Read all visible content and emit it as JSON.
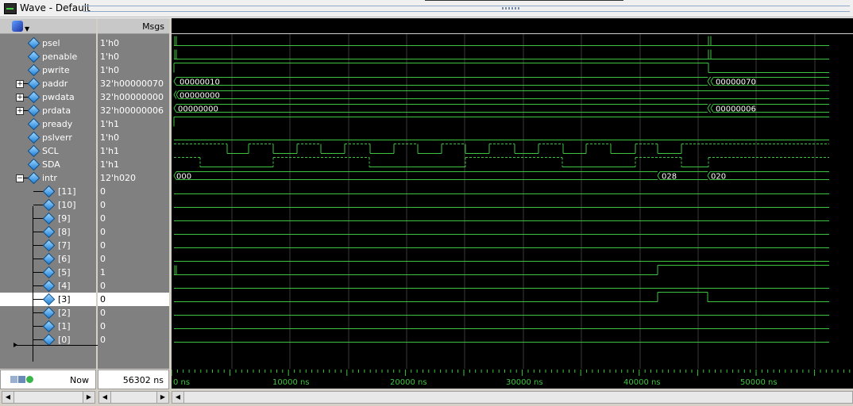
{
  "window": {
    "title": "Wave - Default"
  },
  "header": {
    "msgs_label": "Msgs"
  },
  "signals": [
    {
      "name": "psel",
      "value": "1'h0",
      "expandable": false,
      "expanded": false
    },
    {
      "name": "penable",
      "value": "1'h0",
      "expandable": false,
      "expanded": false
    },
    {
      "name": "pwrite",
      "value": "1'h0",
      "expandable": false,
      "expanded": false
    },
    {
      "name": "paddr",
      "value": "32'h00000070",
      "expandable": true,
      "expanded": false
    },
    {
      "name": "pwdata",
      "value": "32'h00000000",
      "expandable": true,
      "expanded": false
    },
    {
      "name": "prdata",
      "value": "32'h00000006",
      "expandable": true,
      "expanded": false
    },
    {
      "name": "pready",
      "value": "1'h1",
      "expandable": false,
      "expanded": false
    },
    {
      "name": "pslverr",
      "value": "1'h0",
      "expandable": false,
      "expanded": false
    },
    {
      "name": "SCL",
      "value": "1'h1",
      "expandable": false,
      "expanded": false
    },
    {
      "name": "SDA",
      "value": "1'h1",
      "expandable": false,
      "expanded": false
    },
    {
      "name": "intr",
      "value": "12'h020",
      "expandable": true,
      "expanded": true
    }
  ],
  "intr_bits": [
    {
      "name": "[11]",
      "value": "0"
    },
    {
      "name": "[10]",
      "value": "0"
    },
    {
      "name": "[9]",
      "value": "0"
    },
    {
      "name": "[8]",
      "value": "0"
    },
    {
      "name": "[7]",
      "value": "0"
    },
    {
      "name": "[6]",
      "value": "0"
    },
    {
      "name": "[5]",
      "value": "1"
    },
    {
      "name": "[4]",
      "value": "0"
    },
    {
      "name": "[3]",
      "value": "0",
      "selected": true
    },
    {
      "name": "[2]",
      "value": "0"
    },
    {
      "name": "[1]",
      "value": "0"
    },
    {
      "name": "[0]",
      "value": "0"
    }
  ],
  "bus_labels": {
    "paddr": [
      "00000010",
      "00000070"
    ],
    "pwdata": [
      "00000000"
    ],
    "prdata": [
      "00000000",
      "00000006"
    ],
    "intr": [
      "000",
      "028",
      "020"
    ]
  },
  "footer": {
    "now_label": "Now",
    "now_time": "56302 ns"
  },
  "timeline": {
    "ticks": [
      "0 ns",
      "10000 ns",
      "20000 ns",
      "30000 ns",
      "40000 ns",
      "50000 ns"
    ]
  },
  "colors": {
    "wave": "#3ec43e",
    "background": "#000000",
    "panel": "#808080",
    "grid": "#3a3a3a"
  },
  "icons": [
    "wave-window-icon",
    "signal-diamond-icon",
    "expand-plus-icon",
    "collapse-minus-icon",
    "add-cursor-icon",
    "lock-cursor-icon",
    "delete-cursor-icon"
  ]
}
